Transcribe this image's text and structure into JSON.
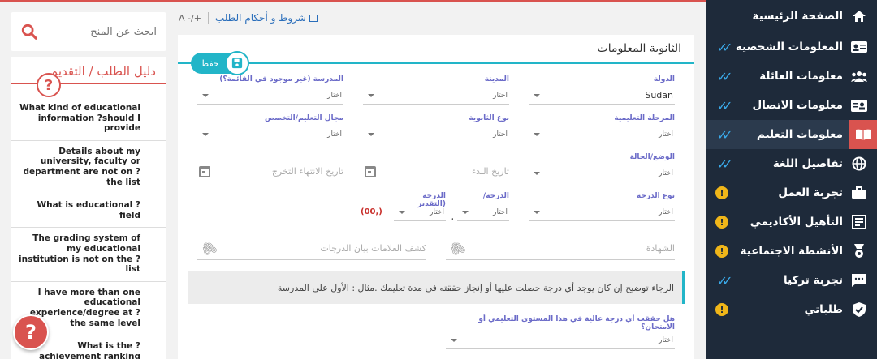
{
  "sidebar": {
    "items": [
      {
        "label": "الصفحة الرئيسية",
        "icon": "home-icon",
        "status": "none"
      },
      {
        "label": "المعلومات الشخصية",
        "icon": "id-card-icon",
        "status": "done"
      },
      {
        "label": "معلومات العائلة",
        "icon": "family-icon",
        "status": "done"
      },
      {
        "label": "معلومات الاتصال",
        "icon": "contact-card-icon",
        "status": "done"
      },
      {
        "label": "معلومات التعليم",
        "icon": "book-icon",
        "status": "done",
        "active": true
      },
      {
        "label": "تفاصيل اللغة",
        "icon": "globe-icon",
        "status": "done"
      },
      {
        "label": "تجربة العمل",
        "icon": "briefcase-icon",
        "status": "warning"
      },
      {
        "label": "التأهيل الأكاديمي",
        "icon": "certificate-icon",
        "status": "warning"
      },
      {
        "label": "الأنشطة الاجتماعية",
        "icon": "award-icon",
        "status": "warning"
      },
      {
        "label": "تجربة تركيا",
        "icon": "chat-icon",
        "status": "done"
      },
      {
        "label": "طلباتي",
        "icon": "shield-check-icon",
        "status": "warning"
      }
    ],
    "warning_mark": "!"
  },
  "search": {
    "placeholder": "ابحث عن المنح"
  },
  "guide": {
    "title": "دليل الطلب / التقديم",
    "badge": "?",
    "items": [
      "What kind of educational information ?should I provide",
      "Details about my university, faculty or department are not on ?the list",
      "What is educational ?field",
      "The grading system of my educational institution is not on the ?list",
      "I have more than one educational experience/degree at ?the same level",
      "What is the ?achievement ranking"
    ]
  },
  "help_fab": "?",
  "toplinks": {
    "font_size": "A -/+",
    "terms": "شروط و أحكام الطلب"
  },
  "form": {
    "title": "الثانوية المعلومات",
    "save": "حفظ",
    "country_label": "الدولة",
    "country_value": "Sudan",
    "city_label": "المدينة",
    "school_label": "المدرسة (غير موجود في القائمة؟)",
    "level_label": "المرحلة التعليمية",
    "hs_type_label": "نوع الثانوية",
    "field_label": "مجال التعليم/التخصص",
    "status_label": "الوضع/الحالة",
    "start_placeholder": "تاريخ البدء",
    "end_placeholder": "تاريخ الانتهاء التخرج",
    "grade_type_label": "نوع الدرجة",
    "grade_label": "الدرجة/",
    "grade_rating_label": "الدرجة (التقدير",
    "grade_sep": ",",
    "scale_note": "(00,)",
    "certificate_placeholder": "الشهادة",
    "transcript_placeholder": "كشف العلامات بيان الدرجات",
    "choose": "اختار",
    "note": "الرجاء توضيح إن كان يوجد أي درجة حصلت عليها أو إنجاز حققته في مدة تعليمك .مثال : الأول على المدرسة",
    "achievement_question": "هل حققت أي درجة عالية في هذا المستوى التعليمي أو الامتحان؟"
  },
  "colors": {
    "sidebar_bg": "#1e2a3a",
    "accent": "#22b5c8",
    "brand_red": "#d9534f",
    "check": "#3aa9e8",
    "warning": "#f0b619",
    "label": "#6b6bc8"
  }
}
